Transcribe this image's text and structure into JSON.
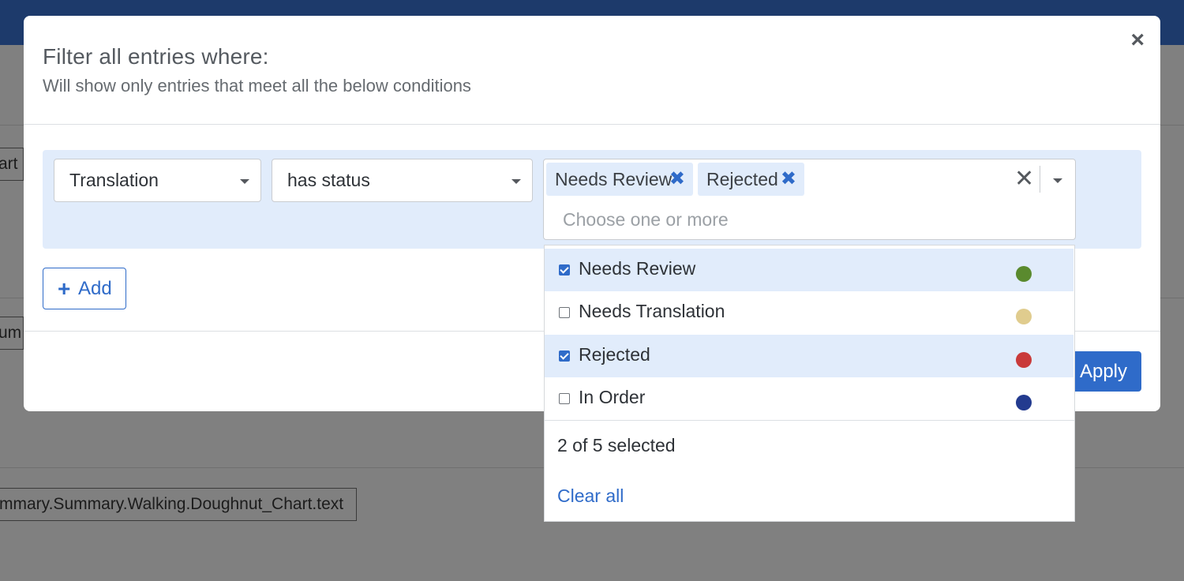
{
  "modal": {
    "title": "Filter all entries where:",
    "subtitle": "Will show only entries that meet all the below conditions",
    "close_label": "×"
  },
  "filter": {
    "field": "Translation",
    "operator": "has status",
    "chips": [
      {
        "label": "Needs Review",
        "remove": "✖"
      },
      {
        "label": "Rejected",
        "remove": "✖"
      }
    ],
    "clear_label": "✕",
    "placeholder": "Choose one or more"
  },
  "add_button": {
    "icon": "+",
    "label": "Add"
  },
  "apply_button": {
    "label": "l Apply"
  },
  "dropdown": {
    "options": [
      {
        "label": "Needs Review",
        "checked": true,
        "color": "#5a8a2e"
      },
      {
        "label": "Needs Translation",
        "checked": false,
        "color": "#e0cc8e"
      },
      {
        "label": "Rejected",
        "checked": true,
        "color": "#c93a3a"
      },
      {
        "label": "In Order",
        "checked": false,
        "color": "#233b8f"
      }
    ],
    "count_text": "2 of 5 selected",
    "clear_all": "Clear all"
  },
  "background": {
    "frag_1": "art",
    "frag_2": "um",
    "path_text": "mmary.Summary.Walking.Doughnut_Chart.text"
  },
  "colors": {
    "accent": "#2f6bc9",
    "header": "#1d3a6b",
    "chip_bg": "#e1ecfb"
  }
}
